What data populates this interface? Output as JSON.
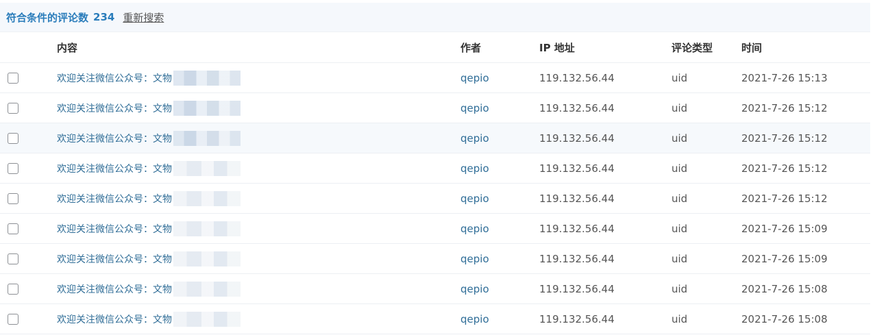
{
  "summary": {
    "label": "符合条件的评论数",
    "count": "234",
    "research_link": "重新搜索"
  },
  "columns": {
    "content": "内容",
    "author": "作者",
    "ip": "IP 地址",
    "type": "评论类型",
    "time": "时间"
  },
  "rows": [
    {
      "content": "欢迎关注微信公众号：文物",
      "author": "qepio",
      "ip": "119.132.56.44",
      "type": "uid",
      "time": "2021-7-26 15:13"
    },
    {
      "content": "欢迎关注微信公众号：文物",
      "author": "qepio",
      "ip": "119.132.56.44",
      "type": "uid",
      "time": "2021-7-26 15:12"
    },
    {
      "content": "欢迎关注微信公众号：文物",
      "author": "qepio",
      "ip": "119.132.56.44",
      "type": "uid",
      "time": "2021-7-26 15:12"
    },
    {
      "content": "欢迎关注微信公众号：文物",
      "author": "qepio",
      "ip": "119.132.56.44",
      "type": "uid",
      "time": "2021-7-26 15:12"
    },
    {
      "content": "欢迎关注微信公众号：文物",
      "author": "qepio",
      "ip": "119.132.56.44",
      "type": "uid",
      "time": "2021-7-26 15:12"
    },
    {
      "content": "欢迎关注微信公众号：文物",
      "author": "qepio",
      "ip": "119.132.56.44",
      "type": "uid",
      "time": "2021-7-26 15:09"
    },
    {
      "content": "欢迎关注微信公众号：文物",
      "author": "qepio",
      "ip": "119.132.56.44",
      "type": "uid",
      "time": "2021-7-26 15:09"
    },
    {
      "content": "欢迎关注微信公众号：文物",
      "author": "qepio",
      "ip": "119.132.56.44",
      "type": "uid",
      "time": "2021-7-26 15:08"
    },
    {
      "content": "欢迎关注微信公众号：文物",
      "author": "qepio",
      "ip": "119.132.56.44",
      "type": "uid",
      "time": "2021-7-26 15:08"
    }
  ]
}
